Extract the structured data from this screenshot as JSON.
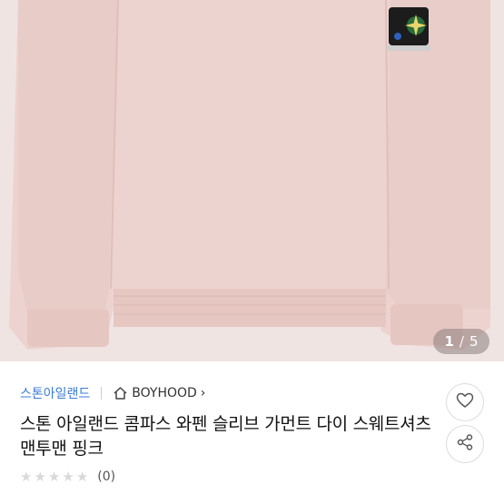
{
  "gallery": {
    "current": "1",
    "separator": "/",
    "total": "5"
  },
  "product": {
    "brand": "스톤아일랜드",
    "shop": "BOYHOOD",
    "shop_chevron": "›",
    "title": "스톤 아일랜드 콤파스 와펜 슬리브 가먼트 다이 스웨트셔츠 맨투맨 핑크",
    "rating": {
      "stars": 0,
      "max": 5,
      "star_glyph": "★",
      "review_count": "(0)"
    }
  },
  "icons": {
    "home": "home-icon",
    "like": "heart-icon",
    "share": "share-icon"
  },
  "colors": {
    "brand_link": "#3a7bd5",
    "image_bg": "#efe4e2",
    "garment": "#edd3cf"
  }
}
